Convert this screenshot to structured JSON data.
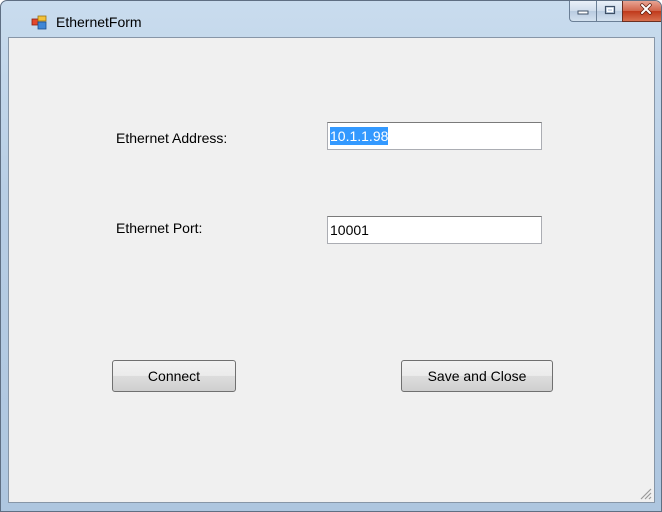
{
  "window": {
    "title": "EthernetForm"
  },
  "form": {
    "address_label": "Ethernet Address:",
    "address_value": "10.1.1.98",
    "port_label": "Ethernet Port:",
    "port_value": "10001"
  },
  "buttons": {
    "connect_label": "Connect",
    "save_close_label": "Save and Close"
  },
  "icons": {
    "app": "app-window-icon",
    "minimize": "minimize-icon",
    "maximize": "maximize-icon",
    "close": "close-icon",
    "grip": "resize-grip-icon"
  },
  "colors": {
    "selection": "#3399ff",
    "close_button": "#c0391b",
    "client_background": "#f0f0f0"
  }
}
